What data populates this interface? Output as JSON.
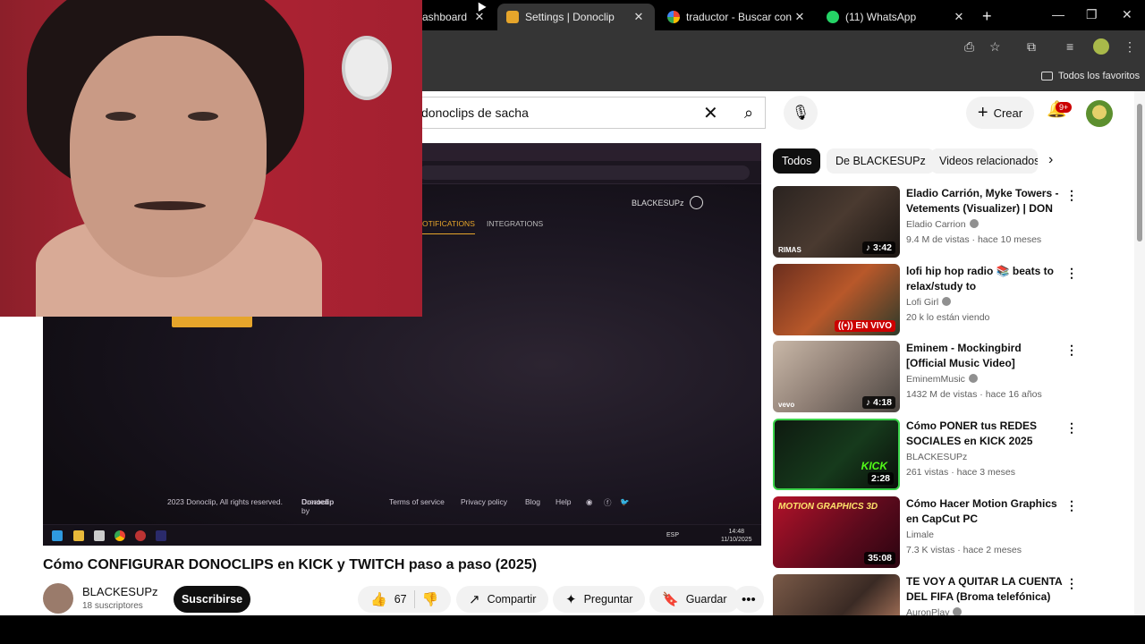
{
  "browser": {
    "tabs": [
      {
        "label": "ashboard",
        "active": false
      },
      {
        "label": "Settings | Donoclip",
        "active": true
      },
      {
        "label": "traductor - Buscar con Google",
        "active": false
      },
      {
        "label": "(11) WhatsApp",
        "active": false
      }
    ],
    "bookmarks_label": "Todos los favoritos"
  },
  "youtube": {
    "search_value": "donoclips de sacha",
    "crear_label": "Crear",
    "notification_count": "9+"
  },
  "player": {
    "username": "BLACKESUPz",
    "nav_items": [
      "OTIFICATIONS",
      "INTEGRATIONS"
    ],
    "footer": {
      "copyright": "2023 Donoclip, All rights reserved.",
      "created_by_prefix": "Created by",
      "created_by_brand": "Donoclip",
      "terms": "Terms of service",
      "privacy": "Privacy policy",
      "blog": "Blog",
      "help": "Help"
    },
    "taskbar": {
      "lang": "ESP",
      "time": "14:48",
      "date": "11/10/2025"
    }
  },
  "video": {
    "title": "Cómo CONFIGURAR DONOCLIPS en KICK y TWITCH paso a paso (2025)",
    "channel": "BLACKESUPz",
    "subscribers": "18 suscriptores",
    "subscribe_label": "Suscribirse",
    "likes": "67",
    "share_label": "Compartir",
    "ask_label": "Preguntar",
    "save_label": "Guardar"
  },
  "sidebar": {
    "chips": [
      "Todos",
      "De BLACKESUPz",
      "Videos relacionados"
    ],
    "recommendations": [
      {
        "title": "Eladio Carrión, Myke Towers - Vetements (Visualizer) | DON ...",
        "channel": "Eladio Carrion",
        "meta": "9.4 M de vistas · hace 10 meses",
        "duration": "♪ 3:42",
        "brand": "RIMAS",
        "verified": true
      },
      {
        "title": "lofi hip hop radio 📚 beats to relax/study to",
        "channel": "Lofi Girl",
        "meta": "20 k lo están viendo",
        "duration": "((•)) EN VIVO",
        "brand": "",
        "verified": true
      },
      {
        "title": "Eminem - Mockingbird [Official Music Video]",
        "channel": "EminemMusic",
        "meta": "1432 M de vistas · hace 16 años",
        "duration": "♪ 4:18",
        "brand": "vevo",
        "verified": true
      },
      {
        "title": "Cómo PONER tus REDES SOCIALES en KICK 2025 (FACI...",
        "channel": "BLACKESUPz",
        "meta": "261 vistas · hace 3 meses",
        "duration": "2:28",
        "brand": "KICK",
        "verified": false
      },
      {
        "title": "Cómo Hacer Motion Graphics en CapCut PC",
        "channel": "Limale",
        "meta": "7.3 K vistas · hace 2 meses",
        "duration": "35:08",
        "brand": "MOTION GRAPHICS 3D",
        "verified": false
      },
      {
        "title": "TE VOY A QUITAR LA CUENTA DEL FIFA (Broma telefónica) b...",
        "channel": "AuronPlay",
        "meta": "",
        "duration": "",
        "brand": "",
        "verified": true
      }
    ]
  }
}
